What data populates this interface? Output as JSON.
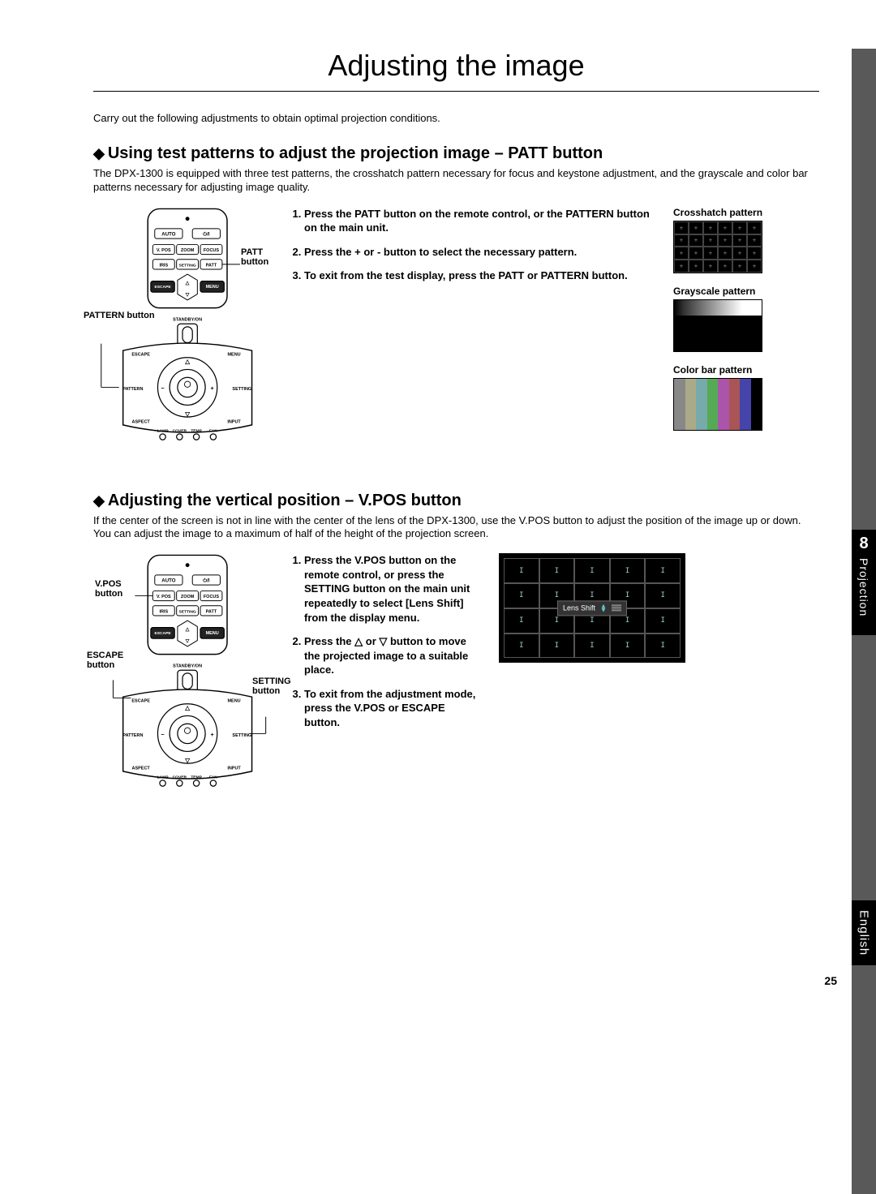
{
  "page_title": "Adjusting the image",
  "intro": "Carry out the following adjustments to obtain optimal projection conditions.",
  "chapter_number": "8",
  "chapter_label": "Projection",
  "language": "English",
  "page_number": "25",
  "section1": {
    "heading": "Using test patterns to adjust the projection image – PATT button",
    "intro": "The DPX-1300 is equipped with three test patterns, the crosshatch pattern necessary for focus and keystone adjustment, and the grayscale and color bar patterns necessary for adjusting image quality.",
    "steps": [
      "Press the PATT button on the remote control, or the PATTERN button on the main unit.",
      "Press the + or - button to select the necessary pattern.",
      "To exit from the test display, press the PATT or PATTERN button."
    ],
    "callouts": {
      "patt": "PATT button",
      "pattern": "PATTERN button"
    },
    "patterns": {
      "crosshatch": "Crosshatch pattern",
      "grayscale": "Grayscale pattern",
      "colorbar": "Color bar pattern"
    }
  },
  "section2": {
    "heading": "Adjusting the vertical position – V.POS button",
    "intro": "If the center of the screen is not in line with the center of the lens of the DPX-1300, use the V.POS button to adjust the position of the image up or down. You can adjust the image to a maximum of half of the height of the projection screen.",
    "steps": [
      "Press the V.POS button on the remote control, or press the SETTING button on the main unit repeatedly to select [Lens Shift] from the display menu.",
      "Press the △ or ▽ button to move the projected image to a suitable place.",
      "To exit from the adjustment mode, press the V.POS or ESCAPE button."
    ],
    "callouts": {
      "vpos": "V.POS button",
      "escape": "ESCAPE button",
      "setting": "SETTING button"
    },
    "lens_shift_label": "Lens Shift"
  },
  "remote_buttons": {
    "auto": "AUTO",
    "power": "⏻/I",
    "vpos": "V. POS",
    "zoom": "ZOOM",
    "focus": "FOCUS",
    "iris": "IRIS",
    "setting": "SETTING",
    "patt": "PATT",
    "escape": "ESCAPE",
    "menu": "MENU",
    "standby": "STANDBY/ON",
    "input": "INPUT",
    "aspect": "ASPECT",
    "pattern": "PATTERN",
    "lamp": "LAMP",
    "cover": "COVER",
    "temp": "TEMP",
    "fan": "FAN"
  }
}
